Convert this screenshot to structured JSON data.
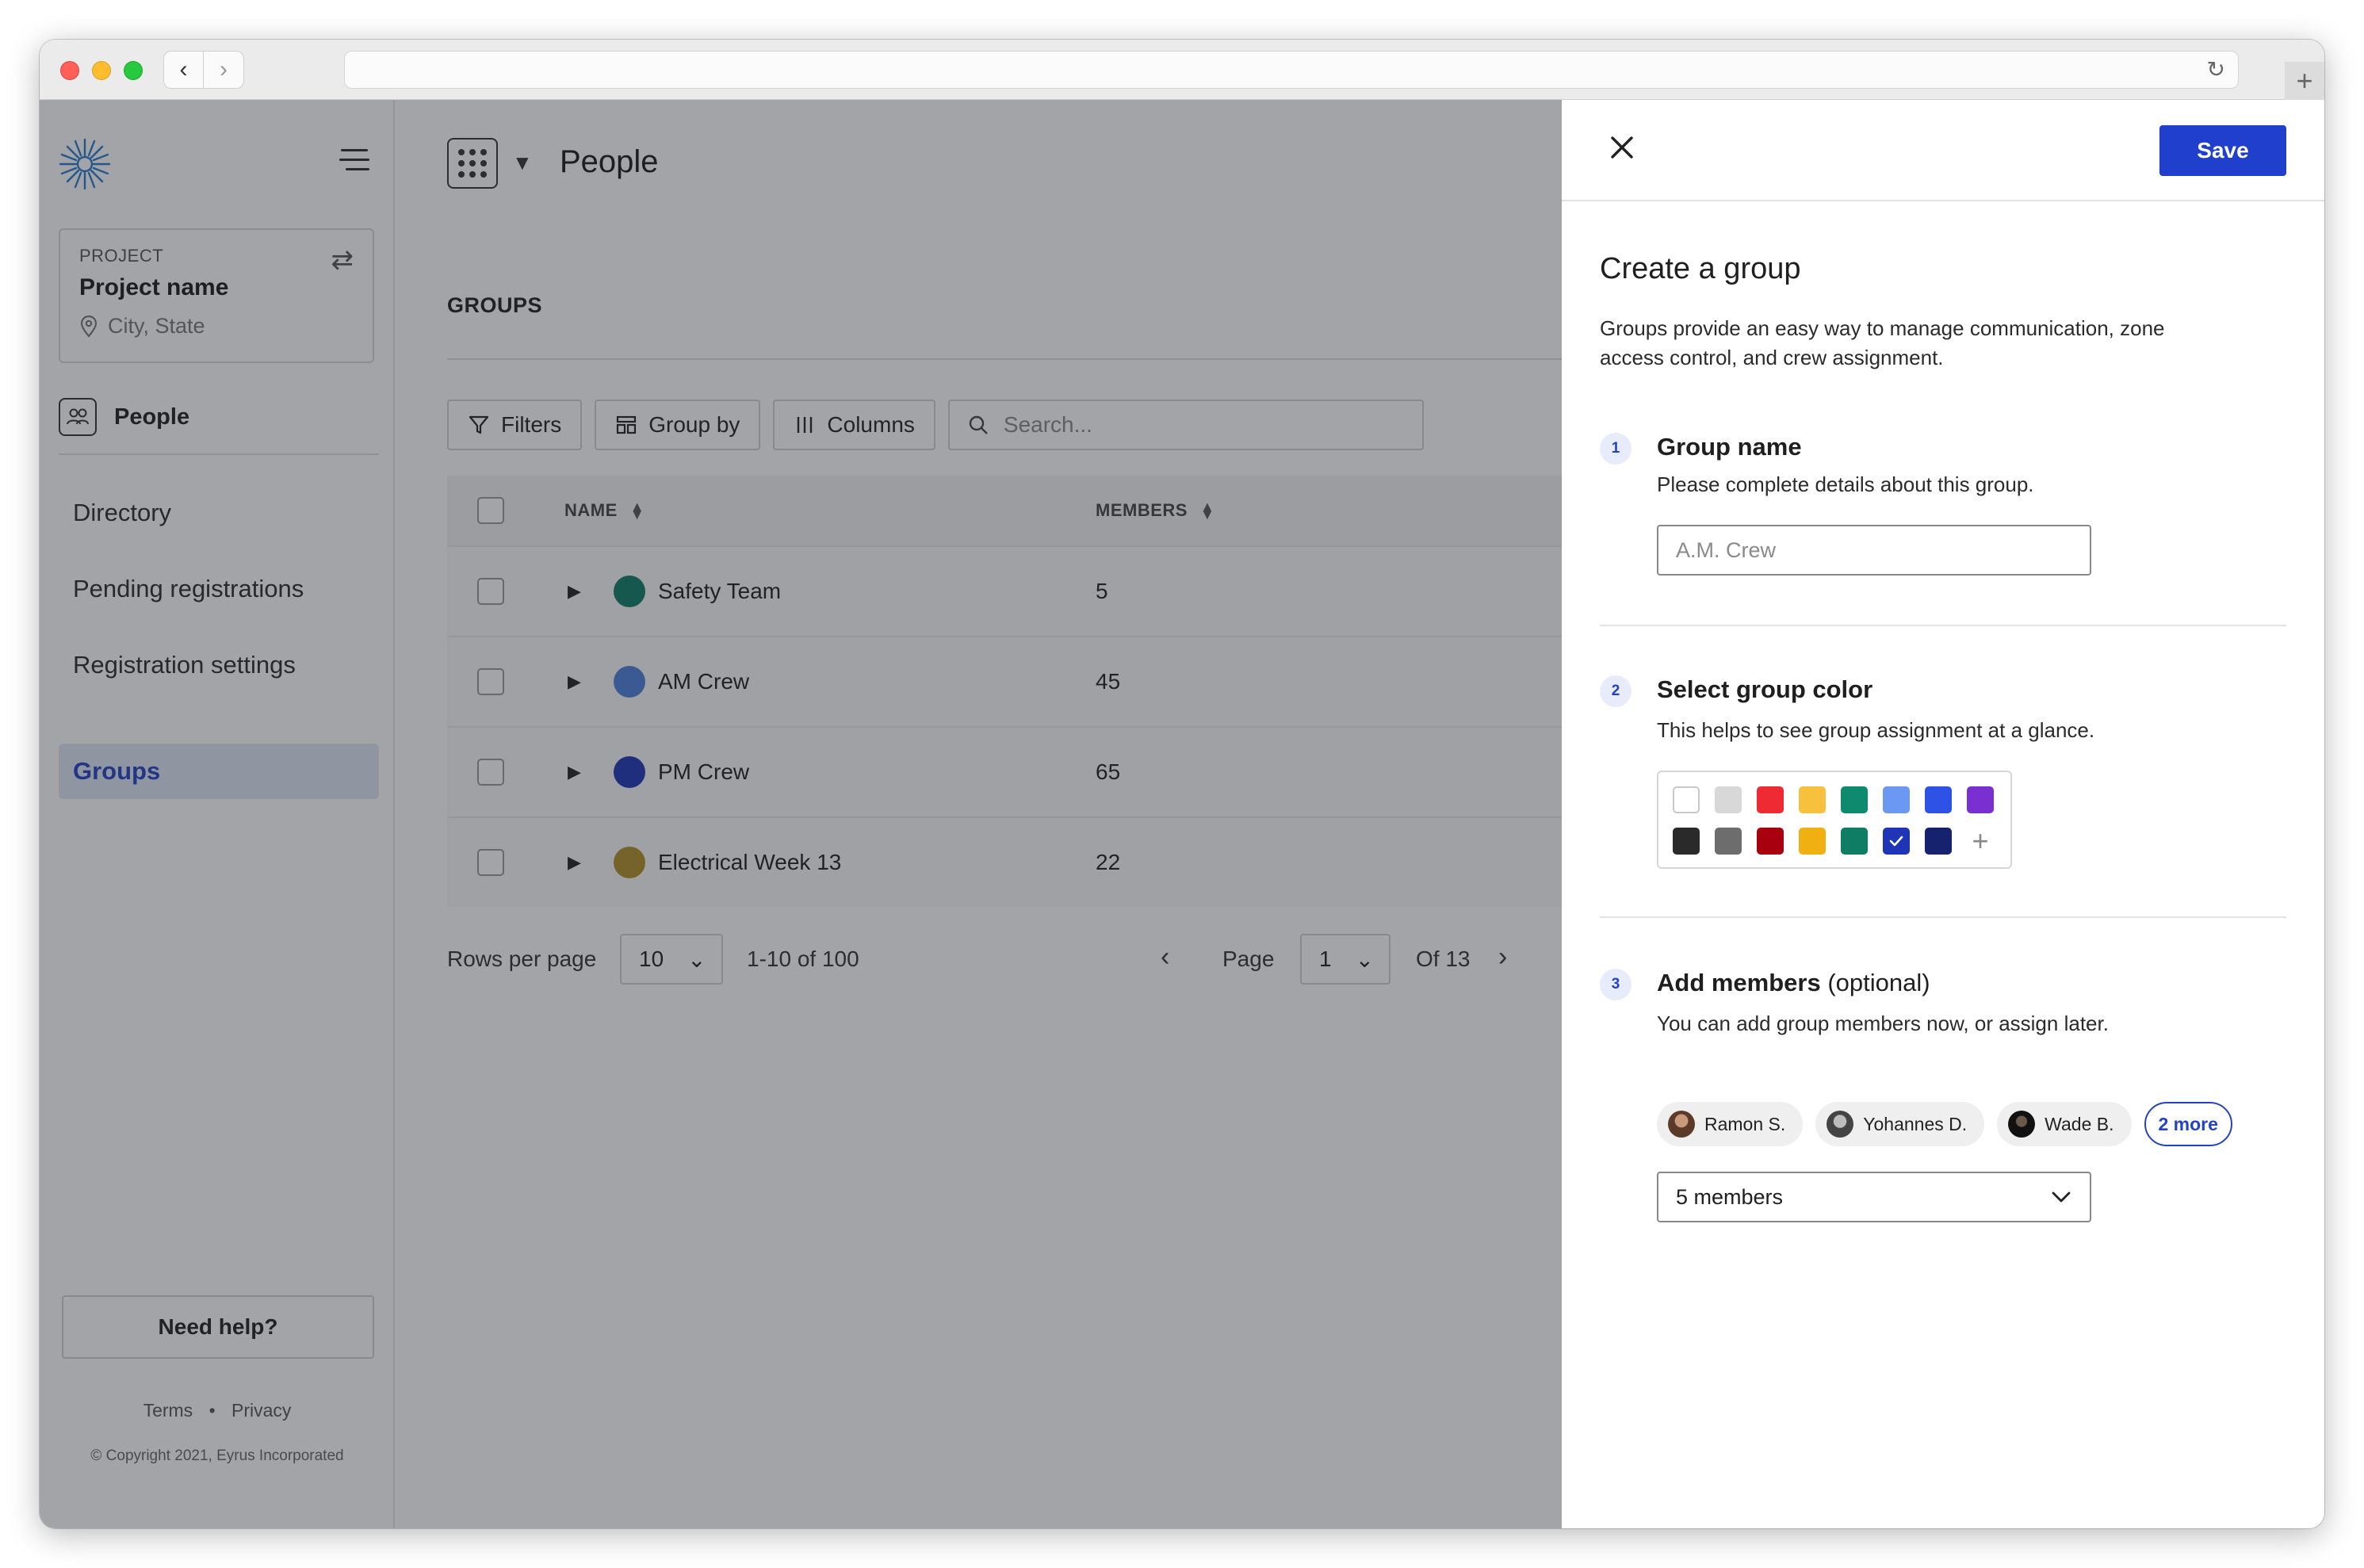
{
  "sidebar": {
    "project_label": "PROJECT",
    "project_name": "Project name",
    "project_location": "City, State",
    "section_title": "People",
    "nav": [
      {
        "label": "Directory"
      },
      {
        "label": "Pending registrations"
      },
      {
        "label": "Registration settings"
      },
      {
        "label": "Groups",
        "active": true
      }
    ],
    "help_label": "Need help?",
    "terms": "Terms",
    "dot": "•",
    "privacy": "Privacy",
    "copyright": "© Copyright 2021, Eyrus Incorporated"
  },
  "main": {
    "page_title": "People",
    "section_label": "GROUPS",
    "toolbar": {
      "filters": "Filters",
      "group_by": "Group by",
      "columns": "Columns",
      "search_placeholder": "Search..."
    },
    "table": {
      "headers": {
        "name": "NAME",
        "members": "MEMBERS"
      },
      "rows": [
        {
          "name": "Safety Team",
          "members": "5",
          "color": "#0e7d64"
        },
        {
          "name": "AM Crew",
          "members": "45",
          "color": "#4f7fdc"
        },
        {
          "name": "PM Crew",
          "members": "65",
          "color": "#1f35b8"
        },
        {
          "name": "Electrical Week 13",
          "members": "22",
          "color": "#b38f28"
        }
      ]
    },
    "pager": {
      "rows_per_page_label": "Rows per page",
      "rows_per_page": "10",
      "range": "1-10 of 100",
      "page_label": "Page",
      "page": "1",
      "of_label": "Of 13"
    }
  },
  "drawer": {
    "save_label": "Save",
    "title": "Create a group",
    "description": "Groups provide an easy way to manage communication, zone access control, and crew assignment.",
    "step1": {
      "num": "1",
      "title": "Group name",
      "subtitle": "Please complete details about this group.",
      "placeholder": "A.M. Crew"
    },
    "step2": {
      "num": "2",
      "title": "Select group color",
      "subtitle": "This helps to see group assignment at a glance.",
      "selected_color": "#1f35b8",
      "colors": [
        "#ffffff",
        "#d8d8d8",
        "#ee2a33",
        "#f7c13d",
        "#0e8a6e",
        "#6b98f2",
        "#2d52e5",
        "#7a2fd0",
        "#2a2a2a",
        "#6d6d6d",
        "#a8000e",
        "#f0b012",
        "#0e7d64",
        "#1f35b8",
        "#16226e"
      ]
    },
    "step3": {
      "num": "3",
      "title": "Add members",
      "optional": " (optional)",
      "subtitle": "You can add group members now, or assign later.",
      "chips": [
        "Ramon S.",
        "Yohannes D.",
        "Wade B."
      ],
      "more": "2 more",
      "select_value": "5 members"
    }
  }
}
